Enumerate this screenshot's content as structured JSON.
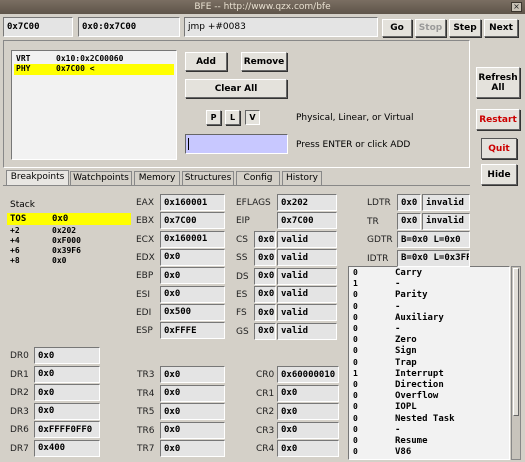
{
  "window": {
    "title": "BFE -- http://www.qzx.com/bfe",
    "close": "×"
  },
  "top": {
    "address": "0x7C00",
    "segaddr": "0x0:0x7C00",
    "instruction": "jmp +#0083",
    "go": "Go",
    "stop": "Stop",
    "step": "Step",
    "next": "Next"
  },
  "breakpoints": {
    "list": [
      {
        "type": "VRT",
        "value": "0x10:0x2C00060"
      },
      {
        "type": "PHY",
        "value": "0x7C00 <"
      }
    ],
    "add": "Add",
    "remove": "Remove",
    "clear_all": "Clear All",
    "mode_p": "P",
    "mode_l": "L",
    "mode_v": "V",
    "mode_hint": "Physical, Linear, or Virtual",
    "input_hint": "Press ENTER or click ADD"
  },
  "side": {
    "refresh": "Refresh All",
    "restart": "Restart",
    "quit": "Quit",
    "hide": "Hide"
  },
  "tabs": [
    "Breakpoints",
    "Watchpoints",
    "Memory",
    "Structures",
    "Config",
    "History"
  ],
  "stack": {
    "title": "Stack",
    "rows": [
      {
        "k": "TOS",
        "v": "0x0"
      },
      {
        "k": "+2",
        "v": "0x202"
      },
      {
        "k": "+4",
        "v": "0xF000"
      },
      {
        "k": "+6",
        "v": "0x39F6"
      },
      {
        "k": "+8",
        "v": "0x0"
      }
    ]
  },
  "gpr": [
    {
      "n": "EAX",
      "v": "0x160001"
    },
    {
      "n": "EBX",
      "v": "0x7C00"
    },
    {
      "n": "ECX",
      "v": "0x160001"
    },
    {
      "n": "EDX",
      "v": "0x0"
    },
    {
      "n": "EBP",
      "v": "0x0"
    },
    {
      "n": "ESI",
      "v": "0x0"
    },
    {
      "n": "EDI",
      "v": "0x500"
    },
    {
      "n": "ESP",
      "v": "0xFFFE"
    }
  ],
  "eflags": {
    "n": "EFLAGS",
    "v": "0x202"
  },
  "eip": {
    "n": "EIP",
    "v": "0x7C00"
  },
  "seg": [
    {
      "n": "CS",
      "v": "0x0",
      "s": "valid"
    },
    {
      "n": "SS",
      "v": "0x0",
      "s": "valid"
    },
    {
      "n": "DS",
      "v": "0x0",
      "s": "valid"
    },
    {
      "n": "ES",
      "v": "0x0",
      "s": "valid"
    },
    {
      "n": "FS",
      "v": "0x0",
      "s": "valid"
    },
    {
      "n": "GS",
      "v": "0x0",
      "s": "valid"
    }
  ],
  "sys": [
    {
      "n": "LDTR",
      "v": "0x0",
      "s": "invalid"
    },
    {
      "n": "TR",
      "v": "0x0",
      "s": "invalid"
    },
    {
      "n": "GDTR",
      "v": "B=0x0 L=0x0"
    },
    {
      "n": "IDTR",
      "v": "B=0x0 L=0x3FF"
    }
  ],
  "flags": [
    {
      "b": "0",
      "n": "Carry"
    },
    {
      "b": "1",
      "n": "-"
    },
    {
      "b": "0",
      "n": "Parity"
    },
    {
      "b": "0",
      "n": "-"
    },
    {
      "b": "0",
      "n": "Auxiliary"
    },
    {
      "b": "0",
      "n": "-"
    },
    {
      "b": "0",
      "n": "Zero"
    },
    {
      "b": "0",
      "n": "Sign"
    },
    {
      "b": "0",
      "n": "Trap"
    },
    {
      "b": "1",
      "n": "Interrupt"
    },
    {
      "b": "0",
      "n": "Direction"
    },
    {
      "b": "0",
      "n": "Overflow"
    },
    {
      "b": "0",
      "n": "IOPL"
    },
    {
      "b": "0",
      "n": "Nested Task"
    },
    {
      "b": "0",
      "n": "-"
    },
    {
      "b": "0",
      "n": "Resume"
    },
    {
      "b": "0",
      "n": "V86"
    }
  ],
  "dr": [
    {
      "n": "DR0",
      "v": "0x0"
    },
    {
      "n": "DR1",
      "v": "0x0"
    },
    {
      "n": "DR2",
      "v": "0x0"
    },
    {
      "n": "DR3",
      "v": "0x0"
    },
    {
      "n": "DR6",
      "v": "0xFFFF0FF0"
    },
    {
      "n": "DR7",
      "v": "0x400"
    }
  ],
  "tr": [
    {
      "n": "TR3",
      "v": "0x0"
    },
    {
      "n": "TR4",
      "v": "0x0"
    },
    {
      "n": "TR5",
      "v": "0x0"
    },
    {
      "n": "TR6",
      "v": "0x0"
    },
    {
      "n": "TR7",
      "v": "0x0"
    }
  ],
  "cr": [
    {
      "n": "CR0",
      "v": "0x60000010"
    },
    {
      "n": "CR1",
      "v": "0x0"
    },
    {
      "n": "CR2",
      "v": "0x0"
    },
    {
      "n": "CR3",
      "v": "0x0"
    },
    {
      "n": "CR4",
      "v": "0x0"
    }
  ],
  "colors": {
    "highlight": "#ffff00",
    "input": "#c8c8ff",
    "red": "#cc0000"
  }
}
